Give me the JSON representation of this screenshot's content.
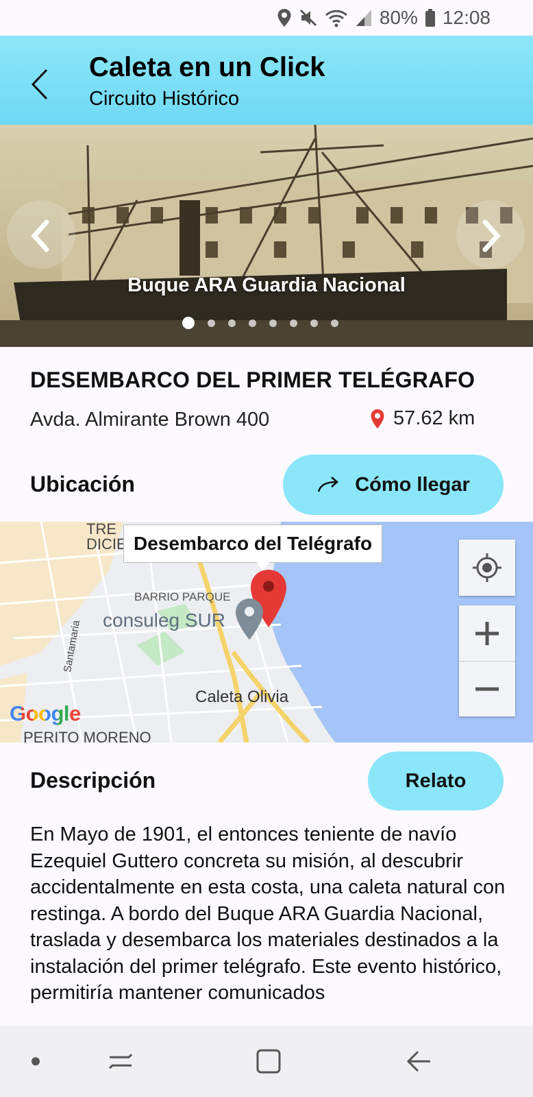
{
  "status_bar": {
    "battery": "80%",
    "time": "12:08"
  },
  "header": {
    "title": "Caleta en un Click",
    "subtitle": "Circuito Histórico"
  },
  "gallery": {
    "caption": "Buque ARA Guardia Nacional",
    "slide_count": 8,
    "active_index": 0
  },
  "place": {
    "title": "DESEMBARCO DEL PRIMER TELÉGRAFO",
    "address": "Avda. Almirante Brown 400",
    "distance": "57.62 km"
  },
  "location": {
    "label": "Ubicación",
    "directions_button": "Cómo llegar"
  },
  "map": {
    "marker_label": "Desembarco del Telégrafo",
    "labels": {
      "barrio": "BARRIO PARQUE",
      "poi": "consuleg SUR",
      "city": "Caleta Olivia",
      "street": "Santamaria",
      "top1": "TRE",
      "top2": "DICIE",
      "bottom": "PERITO MORENO"
    },
    "attribution": "Google"
  },
  "description": {
    "label": "Descripción",
    "story_button": "Relato",
    "text": "En Mayo de 1901, el entonces teniente de navío Ezequiel Guttero concreta su misión, al descubrir accidentalmente en esta costa, una caleta natural con restinga. A bordo del Buque ARA Guardia Nacional, traslada y desembarca los materiales destinados a la instalación del primer telégrafo. Este evento histórico, permitiría mantener comunicados"
  }
}
